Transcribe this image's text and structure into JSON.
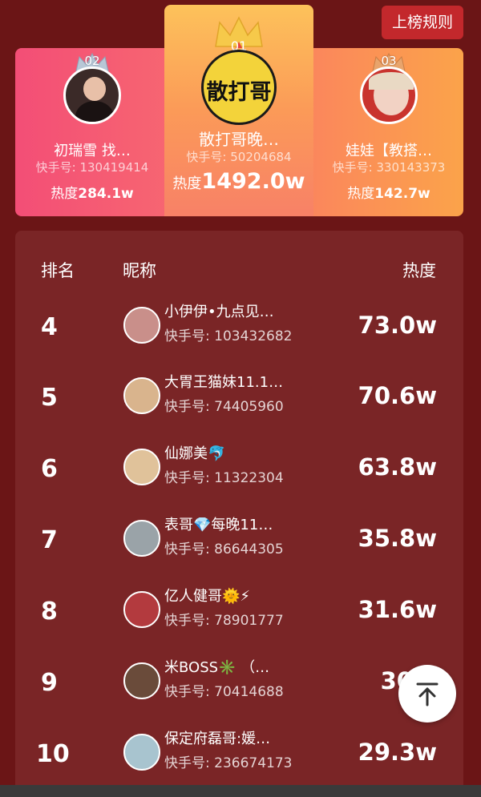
{
  "header": {
    "rules_label": "上榜规则"
  },
  "podium": [
    {
      "rank_label": "02",
      "name": "初瑞雪 找…",
      "uid": "快手号: 130419414",
      "heat_label": "热度",
      "heat_value": "284.1w",
      "crown_color": "#b8c7d6",
      "avatar_bg": "#3b2a28"
    },
    {
      "rank_label": "01",
      "logo_text": "散打哥",
      "name": "散打哥晚…",
      "uid": "快手号: 50204684",
      "heat_label": "热度",
      "heat_value": "1492.0w",
      "crown_color": "#f6c94a",
      "avatar_bg": "#f3d33a"
    },
    {
      "rank_label": "03",
      "name": "娃娃【教搭…",
      "uid": "快手号: 330143373",
      "heat_label": "热度",
      "heat_value": "142.7w",
      "crown_color": "#e8a46c",
      "avatar_bg": "#c9332e"
    }
  ],
  "table": {
    "headers": {
      "rank": "排名",
      "nickname": "昵称",
      "heat": "热度"
    },
    "rows": [
      {
        "rank": "4",
        "name": "小伊伊•九点见…",
        "uid": "快手号: 103432682",
        "heat": "73.0w",
        "avatar_bg": "#c98f8a"
      },
      {
        "rank": "5",
        "name": "大胃王猫妹11.1…",
        "uid": "快手号: 74405960",
        "heat": "70.6w",
        "avatar_bg": "#d9b48d"
      },
      {
        "rank": "6",
        "name": "仙娜美🐬",
        "uid": "快手号: 11322304",
        "heat": "63.8w",
        "avatar_bg": "#e0c29a"
      },
      {
        "rank": "7",
        "name": "表哥💎每晚11…",
        "uid": "快手号: 86644305",
        "heat": "35.8w",
        "avatar_bg": "#9aa3a8"
      },
      {
        "rank": "8",
        "name": "亿人健哥🌞⚡",
        "uid": "快手号: 78901777",
        "heat": "31.6w",
        "avatar_bg": "#b33a3e"
      },
      {
        "rank": "9",
        "name": "米BOSS✳️ （…",
        "uid": "快手号: 70414688",
        "heat": "30",
        "avatar_bg": "#6a4b3a"
      },
      {
        "rank": "10",
        "name": "保定府磊哥:媛…",
        "uid": "快手号: 236674173",
        "heat": "29.3w",
        "avatar_bg": "#a8c4cf"
      }
    ]
  },
  "back_to_top": {
    "icon": "arrow-up-to-top-icon"
  }
}
